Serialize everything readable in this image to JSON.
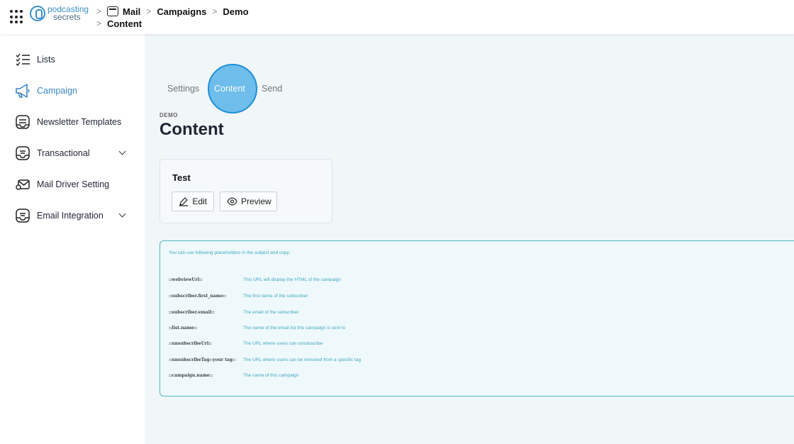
{
  "header": {
    "logo": {
      "line1": "podcasting",
      "line2": "secrets"
    },
    "breadcrumb": [
      "Mail",
      "Campaigns",
      "Demo"
    ],
    "breadcrumb_second_line": "Content",
    "separator": ">"
  },
  "sidebar": {
    "items": [
      {
        "label": "Lists",
        "icon": "list-icon"
      },
      {
        "label": "Campaign",
        "icon": "megaphone-icon",
        "active": true
      },
      {
        "label": "Newsletter Templates",
        "icon": "template-icon"
      },
      {
        "label": "Transactional",
        "icon": "inbox-icon",
        "expandable": true
      },
      {
        "label": "Mail Driver Setting",
        "icon": "mail-settings-icon"
      },
      {
        "label": "Email Integration",
        "icon": "inbox-icon",
        "expandable": true
      }
    ]
  },
  "tabs": [
    {
      "label": "Settings"
    },
    {
      "label": "Content",
      "active": true
    },
    {
      "label": "Send"
    }
  ],
  "page": {
    "overtitle": "DEMO",
    "title": "Content"
  },
  "card": {
    "title": "Test",
    "edit_label": "Edit",
    "preview_label": "Preview"
  },
  "placeholders": {
    "intro": "You can use following placeholders in the subject and copy:",
    "rows": [
      {
        "key": "::webviewUrl::",
        "desc": "This URL will display the HTML of the campaign"
      },
      {
        "key": "::subscriber.first_name::",
        "desc": "The first name of the subscriber"
      },
      {
        "key": "::subscriber.email::",
        "desc": "The email of the subscriber"
      },
      {
        "key": "::list.name::",
        "desc": "The name of the email list this campaign is sent to"
      },
      {
        "key": "::unsubscribeUrl::",
        "desc": "The URL where users can unsubscribe"
      },
      {
        "key": "::unsubscribeTag::your tag::",
        "desc": "The URL where users can be removed from a specific tag"
      },
      {
        "key": "::campaign.name::",
        "desc": "The name of this campaign"
      }
    ]
  },
  "colors": {
    "accent": "#3a86c4",
    "highlight": "#42aae6",
    "info_border": "#4fb8c4"
  }
}
